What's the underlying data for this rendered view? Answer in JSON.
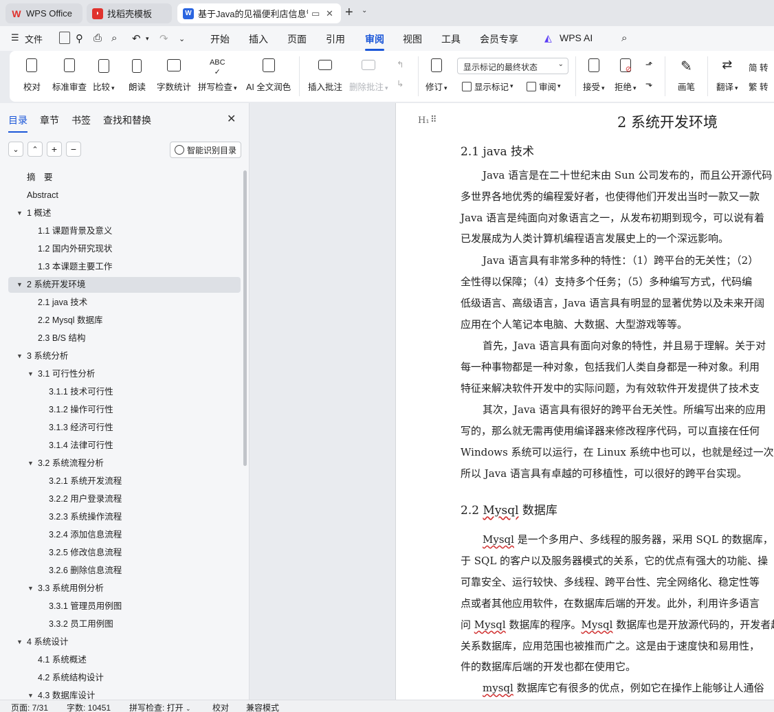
{
  "tabs": [
    {
      "label": "WPS Office",
      "icon": "wps-logo-icon"
    },
    {
      "label": "找稻壳模板",
      "icon": "docer-icon"
    },
    {
      "label": "基于Java的见福便利店信息管",
      "icon": "word-doc-icon",
      "active": true
    }
  ],
  "menu": {
    "file": "文件",
    "items": [
      "开始",
      "插入",
      "页面",
      "引用",
      "审阅",
      "视图",
      "工具",
      "会员专享"
    ],
    "active": "审阅",
    "wps_ai": "WPS AI"
  },
  "ribbon": {
    "proofread": "校对",
    "standard_review": "标准审查",
    "compare": "比较",
    "read_aloud": "朗读",
    "word_count": "字数统计",
    "spell_check": "拼写检查",
    "ai_polish": "AI 全文润色",
    "insert_comment": "插入批注",
    "delete_comment": "删除批注",
    "track_changes": "修订",
    "display_mode": "显示标记的最终状态",
    "show_markup": "显示标记",
    "review": "审阅",
    "accept": "接受",
    "reject": "拒绝",
    "pen": "画笔",
    "translate": "翻译",
    "to_simplified": "简 转",
    "to_traditional": "繁 转"
  },
  "panel": {
    "tabs": [
      "目录",
      "章节",
      "书签",
      "查找和替换"
    ],
    "smart_toc": "智能识别目录"
  },
  "toc": [
    {
      "label": "摘　要",
      "level": 1,
      "arrow": false
    },
    {
      "label": "Abstract",
      "level": 1,
      "arrow": false
    },
    {
      "label": "1  概述",
      "level": 1,
      "arrow": true
    },
    {
      "label": "1.1 课题背景及意义",
      "level": 2,
      "arrow": false
    },
    {
      "label": "1.2  国内外研究现状",
      "level": 2,
      "arrow": false
    },
    {
      "label": "1.3  本课题主要工作",
      "level": 2,
      "arrow": false
    },
    {
      "label": "2  系统开发环境",
      "level": 1,
      "arrow": true,
      "selected": true
    },
    {
      "label": "2.1 java 技术",
      "level": 2,
      "arrow": false
    },
    {
      "label": "2.2 Mysql 数据库",
      "level": 2,
      "arrow": false
    },
    {
      "label": "2.3 B/S 结构",
      "level": 2,
      "arrow": false
    },
    {
      "label": "3  系统分析",
      "level": 1,
      "arrow": true
    },
    {
      "label": "3.1  可行性分析",
      "level": 2,
      "arrow": true
    },
    {
      "label": "3.1.1  技术可行性",
      "level": 3,
      "arrow": false
    },
    {
      "label": "3.1.2 操作可行性",
      "level": 3,
      "arrow": false
    },
    {
      "label": "3.1.3  经济可行性",
      "level": 3,
      "arrow": false
    },
    {
      "label": "3.1.4  法律可行性",
      "level": 3,
      "arrow": false
    },
    {
      "label": "3.2 系统流程分析",
      "level": 2,
      "arrow": true
    },
    {
      "label": "3.2.1 系统开发流程",
      "level": 3,
      "arrow": false
    },
    {
      "label": "3.2.2  用户登录流程",
      "level": 3,
      "arrow": false
    },
    {
      "label": "3.2.3  系统操作流程",
      "level": 3,
      "arrow": false
    },
    {
      "label": "3.2.4  添加信息流程",
      "level": 3,
      "arrow": false
    },
    {
      "label": "3.2.5  修改信息流程",
      "level": 3,
      "arrow": false
    },
    {
      "label": "3.2.6  删除信息流程",
      "level": 3,
      "arrow": false
    },
    {
      "label": "3.3 系统用例分析",
      "level": 2,
      "arrow": true
    },
    {
      "label": "3.3.1 管理员用例图",
      "level": 3,
      "arrow": false
    },
    {
      "label": "3.3.2 员工用例图",
      "level": 3,
      "arrow": false
    },
    {
      "label": "4  系统设计",
      "level": 1,
      "arrow": true
    },
    {
      "label": "4.1  系统概述",
      "level": 2,
      "arrow": false
    },
    {
      "label": "4.2  系统结构设计",
      "level": 2,
      "arrow": false
    },
    {
      "label": "4.3 数据库设计",
      "level": 2,
      "arrow": true
    }
  ],
  "document": {
    "heading_marker": "H₁",
    "chapter_title": "2  系统开发环境",
    "section_java": "2.1 java 技术",
    "java_lines": [
      "Java 语言是在二十世纪末由 Sun 公司发布的，而且公开源代码",
      "多世界各地优秀的编程爱好者，也使得他们开发出当时一款又一款",
      "Java 语言是纯面向对象语言之一，从发布初期到现今，可以说有着",
      "已发展成为人类计算机编程语言发展史上的一个深远影响。",
      "Java 语言具有非常多种的特性：（1）跨平台的无关性；（2）",
      "全性得以保障；（4）支持多个任务；（5）多种编写方式，代码编",
      "低级语言、高级语言，Java 语言具有明显的显著优势以及未来开阔",
      "应用在个人笔记本电脑、大数据、大型游戏等等。",
      "首先，Java 语言具有面向对象的特性，并且易于理解。关于对",
      "每一种事物都是一种对象，包括我们人类自身都是一种对象。利用",
      "特征来解决软件开发中的实际问题，为有效软件开发提供了技术支",
      "其次，Java 语言具有很好的跨平台无关性。所编写出来的应用",
      "写的，那么就无需再使用编译器来修改程序代码，可以直接在任何",
      "Windows 系统可以运行，在 Linux 系统中也可以，也就是经过一次编",
      "所以 Java 语言具有卓越的可移植性，可以很好的跨平台实现。"
    ],
    "section_mysql_num": "2.2 ",
    "section_mysql_word": "Mysql",
    "section_mysql_rest": " 数据库",
    "mysql_lines": [
      {
        "pre": "",
        "wavy": "Mysql",
        "post": " 是一个多用户、多线程的服务器，采用 SQL 的数据库，"
      },
      {
        "pre": "于 SQL 的客户以及服务器模式的关系，它的优点有强大的功能、操",
        "wavy": "",
        "post": ""
      },
      {
        "pre": "可靠安全、运行较快、多线程、跨平台性、完全网络化、稳定性等",
        "wavy": "",
        "post": ""
      },
      {
        "pre": "点或者其他应用软件，在数据库后端的开发。此外，利用许多语言",
        "wavy": "",
        "post": ""
      },
      {
        "pre": "问 ",
        "wavy": "Mysql",
        "post": " 数据库的程序。",
        "wavy2": "Mysql",
        "post2": " 数据库也是开放源代码的，开发者趋"
      },
      {
        "pre": "关系数据库，应用范围也被推而广之。这是由于速度快和易用性，",
        "wavy": "",
        "post": ""
      },
      {
        "pre": "件的数据库后端的开发也都在使用它。",
        "wavy": "",
        "post": ""
      },
      {
        "pre": "",
        "wavy": "mysql",
        "post": " 数据库它有很多的优点，例如它在操作上能够让人通俗"
      }
    ]
  },
  "status": {
    "page": "页面: 7/31",
    "words": "字数: 10451",
    "spell": "拼写检查: 打开",
    "proof": "校对",
    "compat": "兼容模式"
  }
}
